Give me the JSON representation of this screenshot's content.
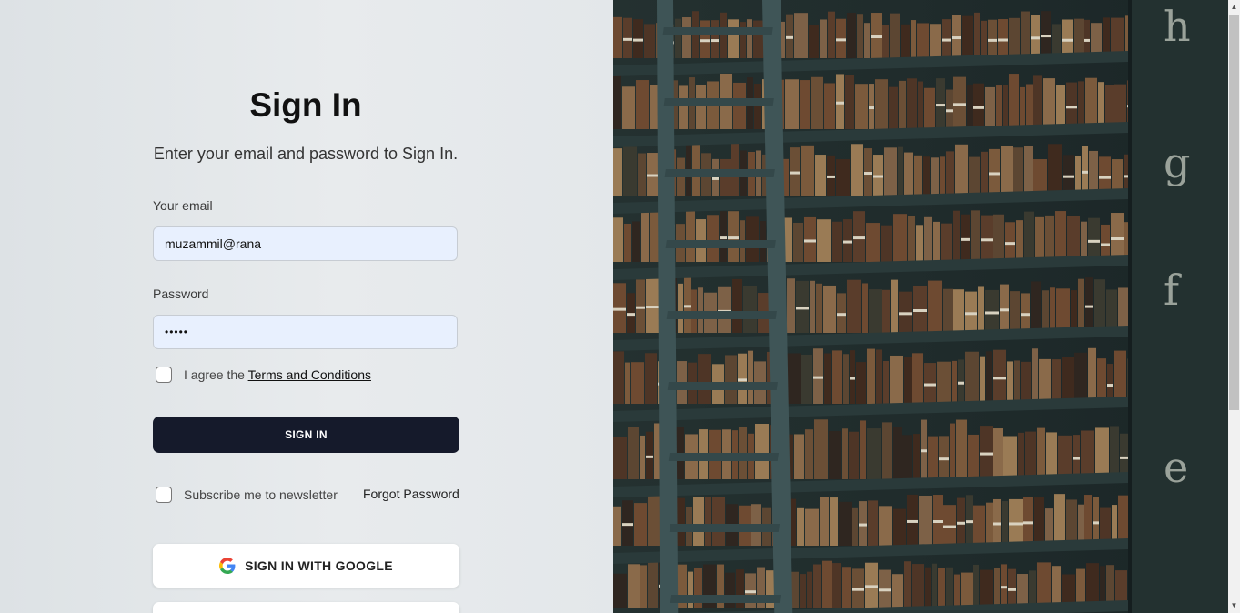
{
  "form": {
    "title": "Sign In",
    "subtitle": "Enter your email and password to Sign In.",
    "email_label": "Your email",
    "email_value": "muzammil@rana",
    "password_label": "Password",
    "password_value": "•••••",
    "terms_prefix": "I agree the ",
    "terms_link": "Terms and Conditions",
    "sign_in_button": "SIGN IN",
    "newsletter_label": "Subscribe me to newsletter",
    "forgot_password": "Forgot Password",
    "google_button": "SIGN IN WITH GOOGLE"
  },
  "image": {
    "spine_letters": [
      "h",
      "g",
      "f",
      "e"
    ]
  },
  "colors": {
    "primary_button": "#151a2b",
    "input_bg": "#e8f0fe"
  }
}
